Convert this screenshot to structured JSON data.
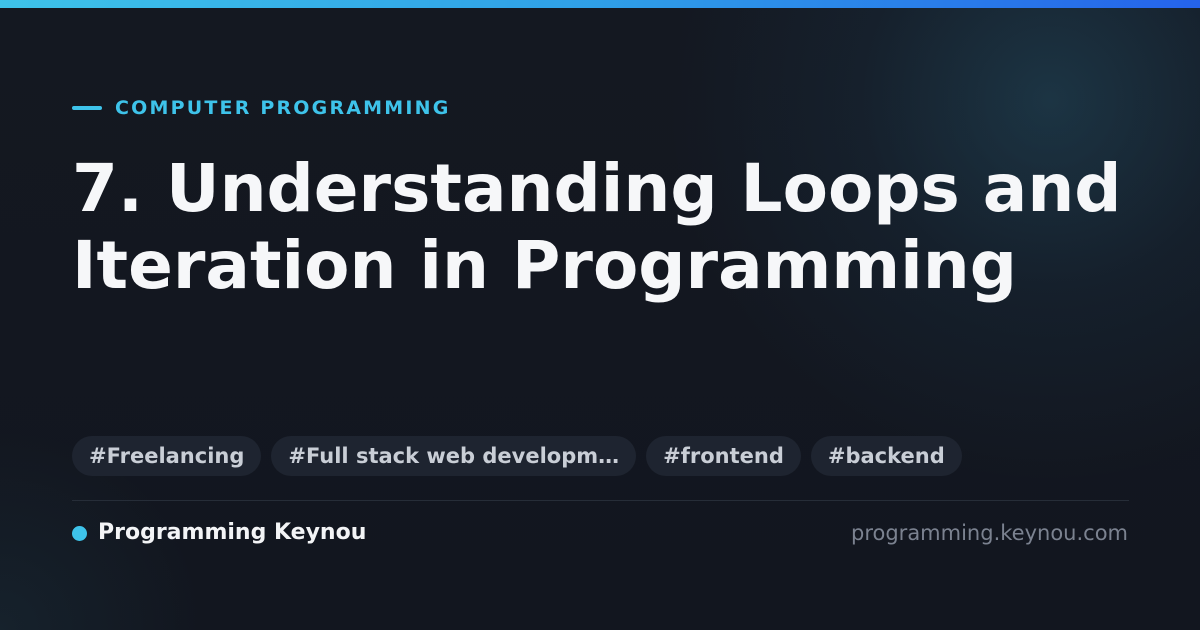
{
  "card": {
    "category": "COMPUTER PROGRAMMING",
    "title": "7. Understanding Loops and Iteration in Programming",
    "tags": [
      "#Freelancing",
      "#Full stack web developm…",
      "#frontend",
      "#backend"
    ],
    "brand": "Programming Keynou",
    "url": "programming.keynou.com"
  },
  "colors": {
    "background": "#12161f",
    "accent": "#3ec3ea",
    "gradient_end": "#2563eb",
    "tag_background": "#1e2430",
    "tag_text": "#c9ced6",
    "title_text": "#f6f7f9",
    "url_text": "#7b8290"
  }
}
